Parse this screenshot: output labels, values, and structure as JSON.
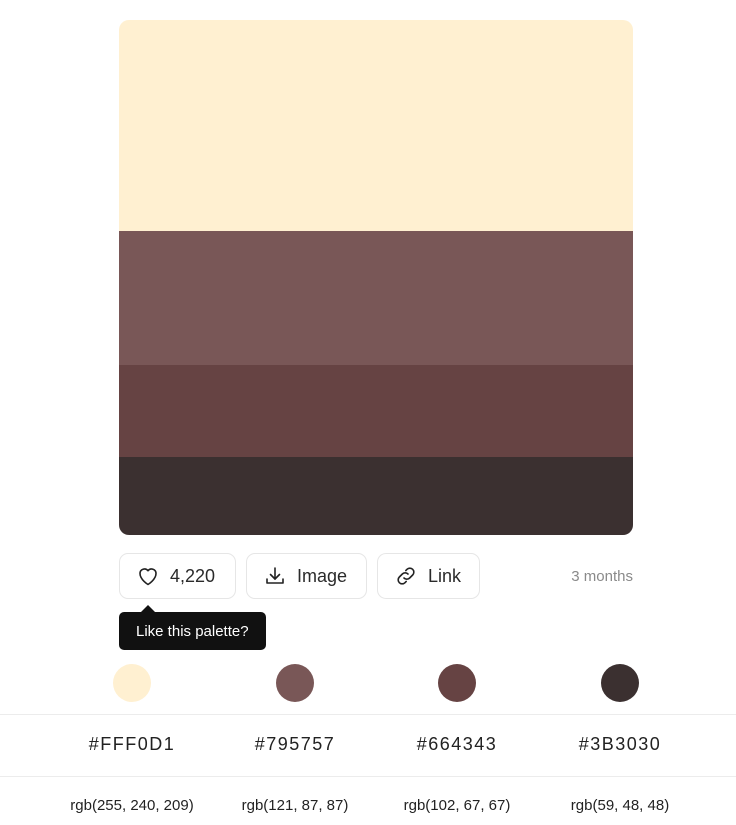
{
  "palette": {
    "colors": [
      {
        "hex": "#FFF0D1",
        "rgb": "rgb(255, 240, 209)"
      },
      {
        "hex": "#795757",
        "rgb": "rgb(121, 87, 87)"
      },
      {
        "hex": "#664343",
        "rgb": "rgb(102, 67, 67)"
      },
      {
        "hex": "#3B3030",
        "rgb": "rgb(59, 48, 48)"
      }
    ]
  },
  "actions": {
    "like_count": "4,220",
    "image_label": "Image",
    "link_label": "Link",
    "time_ago": "3 months",
    "icons": {
      "like": "heart-icon",
      "image": "download-icon",
      "link": "link-icon"
    }
  },
  "tooltip": {
    "text": "Like this palette?"
  }
}
